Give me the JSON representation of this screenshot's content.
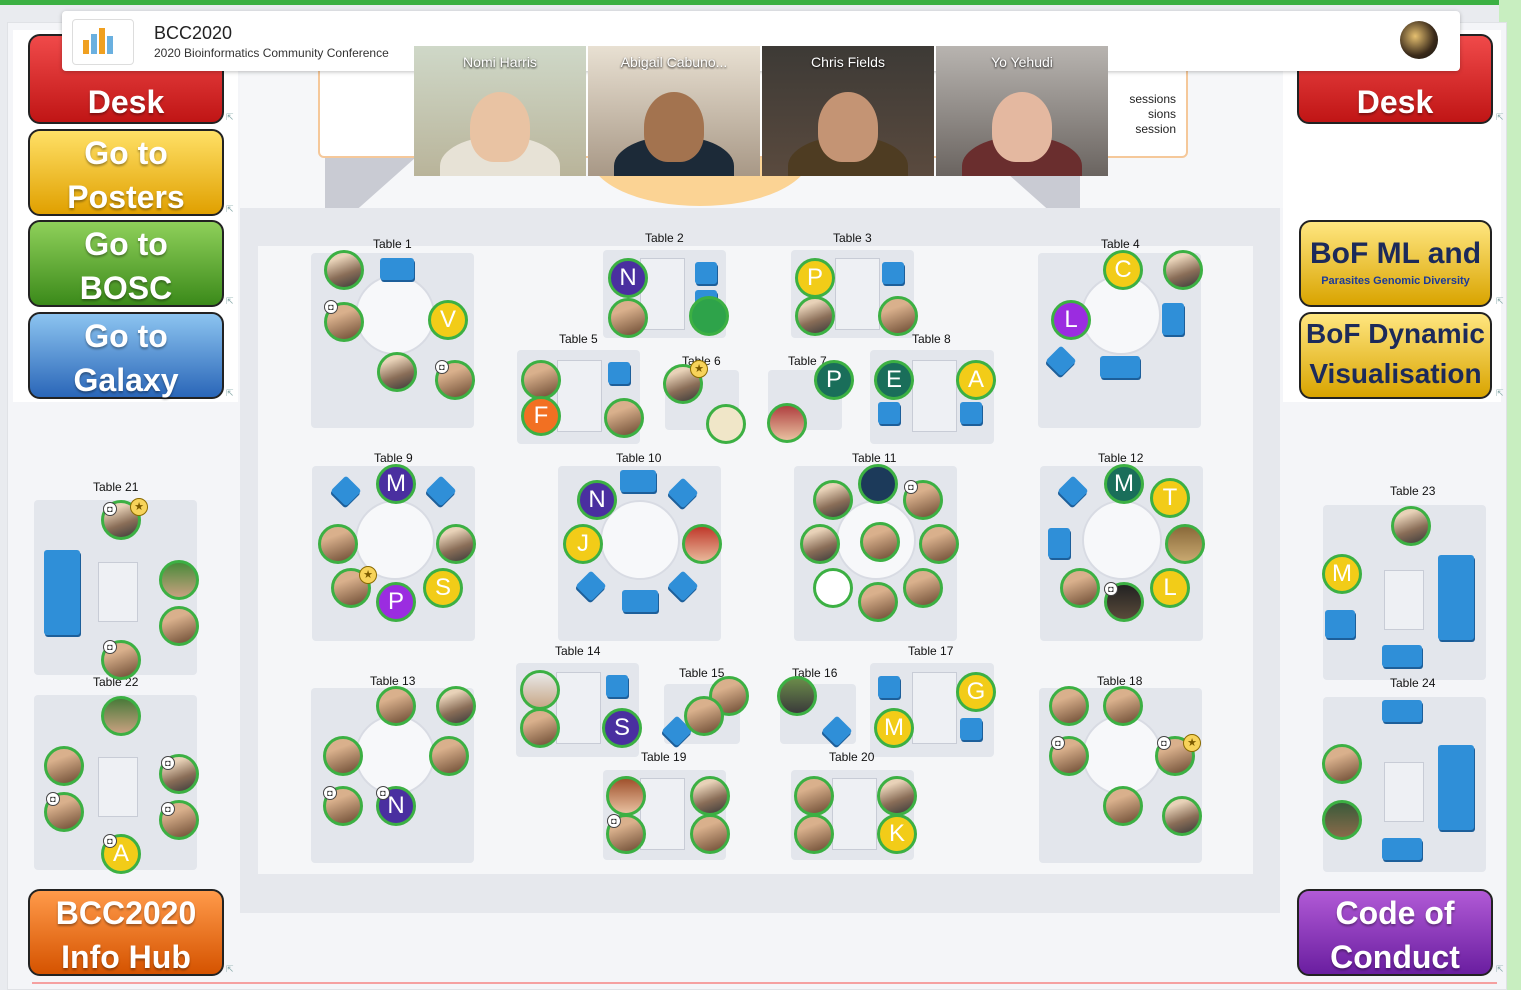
{
  "header": {
    "title": "BCC2020",
    "subtitle": "2020 Bioinformatics Community Conference",
    "logo_alt": "BCC2020 ONLINE"
  },
  "videos": [
    {
      "name": "Nomi Harris"
    },
    {
      "name": "Abigail Cabuno..."
    },
    {
      "name": "Chris Fields"
    },
    {
      "name": "Yo Yehudi"
    }
  ],
  "stage_screen": {
    "lines": [
      "sessions",
      "sions",
      "session"
    ]
  },
  "left_buttons": [
    {
      "line1": "Desk",
      "line2": ""
    },
    {
      "line1": "Go to",
      "line2": "Posters"
    },
    {
      "line1": "Go to",
      "line2": "BOSC"
    },
    {
      "line1": "Go to",
      "line2": "Galaxy"
    },
    {
      "line1": "BCC2020",
      "line2": "Info Hub"
    }
  ],
  "right_buttons": [
    {
      "line1": "Desk",
      "line2": ""
    },
    {
      "line1": "BoF ML and",
      "line2": "Parasites Genomic Diversity"
    },
    {
      "line1": "BoF Dynamic",
      "line2": "Visualisation"
    },
    {
      "line1": "Code of",
      "line2": "Conduct"
    }
  ],
  "tables": [
    "Table 1",
    "Table 2",
    "Table 3",
    "Table 4",
    "Table 5",
    "Table 6",
    "Table 7",
    "Table 8",
    "Table 9",
    "Table 10",
    "Table 11",
    "Table 12",
    "Table 13",
    "Table 14",
    "Table 15",
    "Table 16",
    "Table 17",
    "Table 18",
    "Table 19",
    "Table 20",
    "Table 21",
    "Table 22",
    "Table 23",
    "Table 24"
  ],
  "letters": [
    "V",
    "N",
    "P",
    "C",
    "L",
    "F",
    "P",
    "E",
    "A",
    "M",
    "N",
    "J",
    "M",
    "T",
    "L",
    "P",
    "S",
    "M",
    "N",
    "S",
    "G",
    "M",
    "K",
    "A",
    "M"
  ],
  "colors": {
    "accent_green": "#3cb043",
    "chair_blue": "#2f8fd8"
  }
}
